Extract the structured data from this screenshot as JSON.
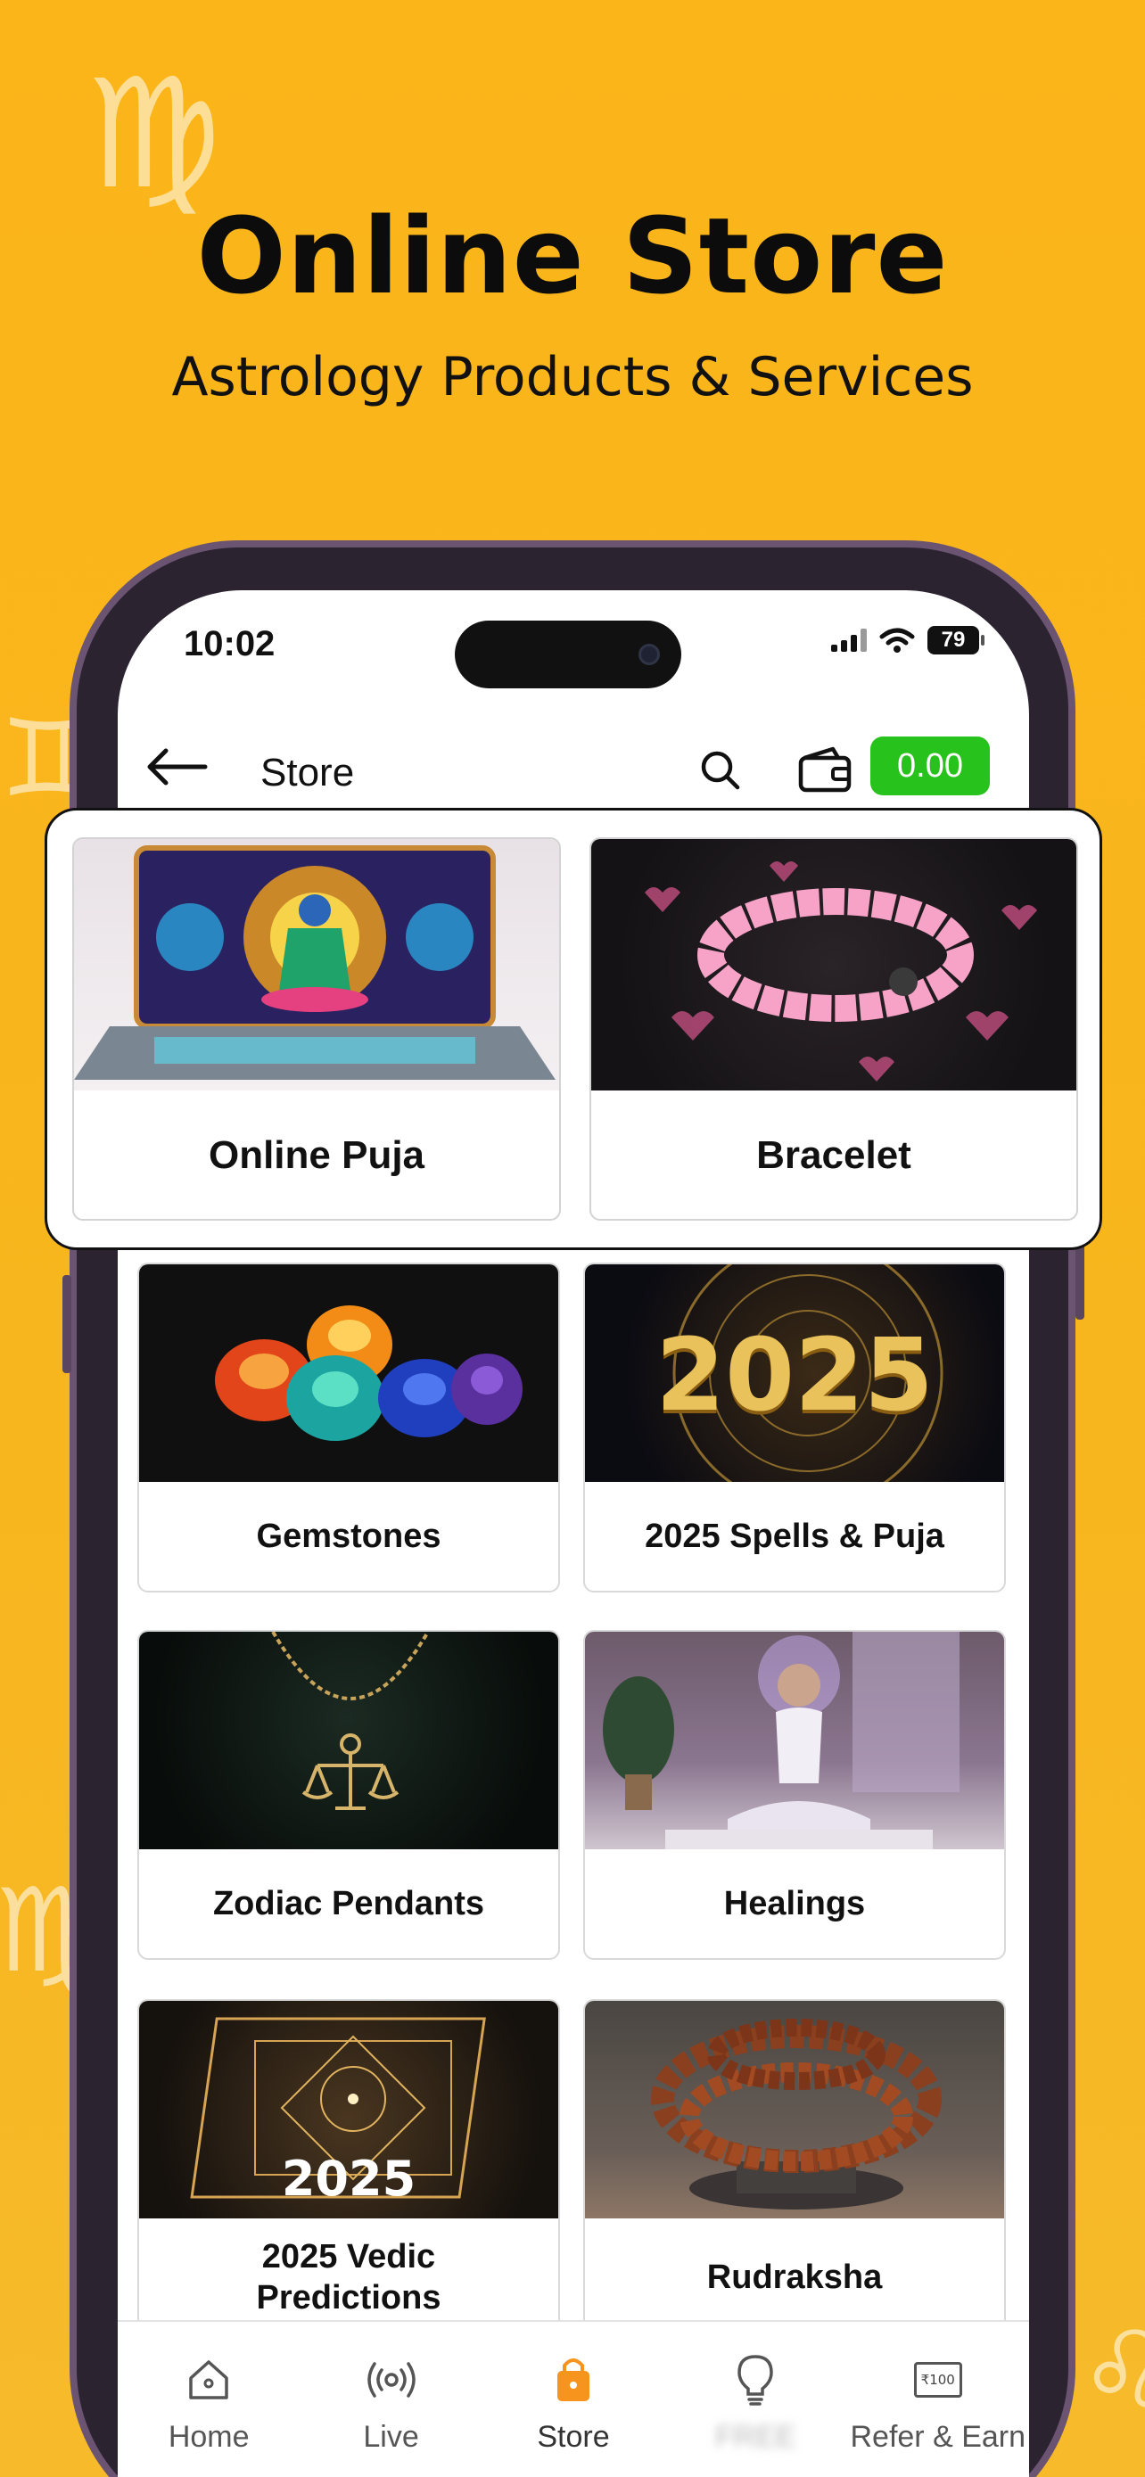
{
  "hero": {
    "title": "Online Store",
    "subtitle": "Astrology Products & Services"
  },
  "status_bar": {
    "time": "10:02",
    "battery": "79"
  },
  "app_bar": {
    "title": "Store",
    "wallet_balance": "0.00"
  },
  "featured_categories": [
    {
      "label": "Online Puja"
    },
    {
      "label": "Bracelet"
    }
  ],
  "categories": [
    {
      "label": "Gemstones"
    },
    {
      "label": "2025 Spells & Puja"
    },
    {
      "label": "Zodiac Pendants"
    },
    {
      "label": "Healings"
    },
    {
      "label": "2025 Vedic Predictions"
    },
    {
      "label": "Rudraksha"
    }
  ],
  "image_text": {
    "year_2025": "2025"
  },
  "bottom_nav": {
    "items": [
      {
        "label": "Home"
      },
      {
        "label": "Live"
      },
      {
        "label": "Store",
        "active": true
      },
      {
        "label": "FREE"
      },
      {
        "label": "Refer & Earn"
      }
    ],
    "refer_badge": "₹100"
  },
  "colors": {
    "background": "#FBB519",
    "wallet_green": "#27C21B",
    "active_nav": "#F7941D"
  }
}
